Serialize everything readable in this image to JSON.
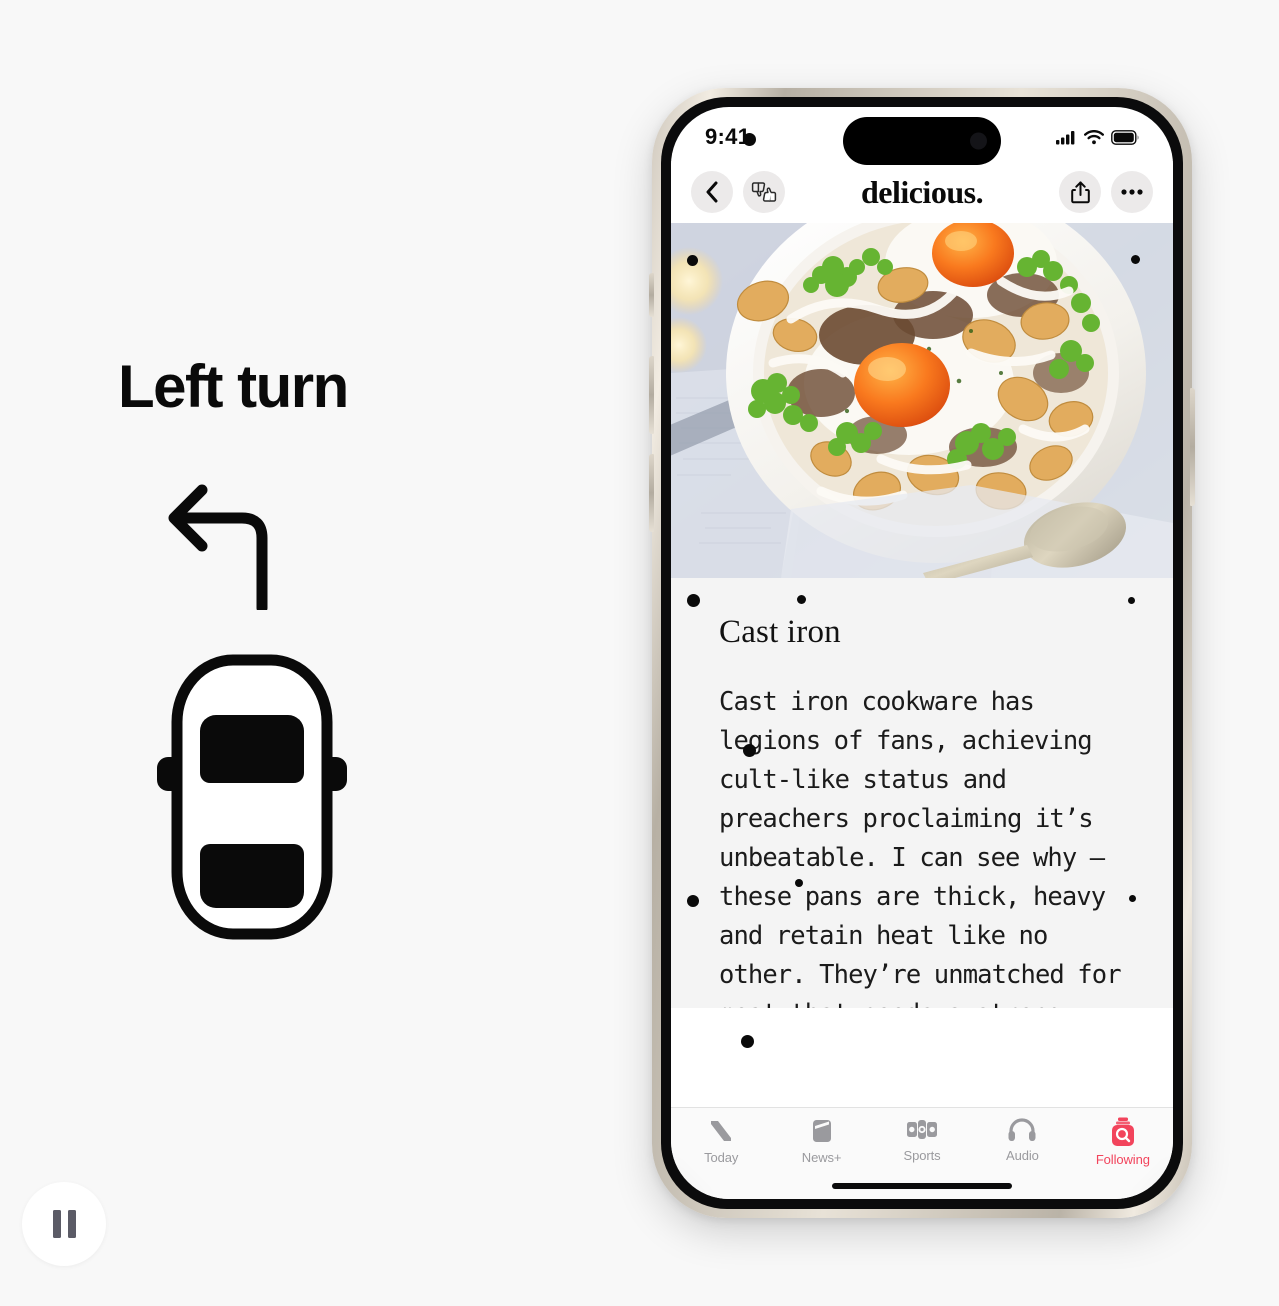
{
  "background_color": "#F8F8F8",
  "accent_color": "#F2445C",
  "navigation": {
    "instruction_title": "Left turn",
    "turn_arrow_icon": "left-turn-arrow-icon",
    "vehicle_icon": "car-top-view-icon",
    "pause_button_label": "",
    "pause_icon": "pause-icon"
  },
  "phone": {
    "status_bar": {
      "time": "9:41",
      "cellular_icon": "cellular-signal-icon",
      "wifi_icon": "wifi-icon",
      "battery_icon": "battery-full-icon"
    },
    "nav_bar": {
      "back_icon": "chevron-left-icon",
      "rating_icon": "thumbs-up-down-icon",
      "brand_title": "delicious.",
      "share_icon": "share-icon",
      "more_icon": "ellipsis-icon"
    },
    "hero": {
      "image_alt": "skillet-of-fried-eggs-potatoes-and-kale"
    },
    "article": {
      "heading": "Cast iron",
      "body": "Cast iron cookware has legions of fans, achieving cult-like status and preachers proclaiming it’s unbeatable. I can see why – these pans are thick, heavy and retain heat like no other. They’re unmatched for meat that needs a strong sear: hav-"
    },
    "tab_bar": {
      "items": [
        {
          "label": "Today",
          "icon": "news-logo-icon",
          "active": false
        },
        {
          "label": "News+",
          "icon": "newsplus-icon",
          "active": false
        },
        {
          "label": "Sports",
          "icon": "sports-icon",
          "active": false
        },
        {
          "label": "Audio",
          "icon": "headphones-icon",
          "active": false
        },
        {
          "label": "Following",
          "icon": "following-search-icon",
          "active": true
        }
      ]
    }
  }
}
